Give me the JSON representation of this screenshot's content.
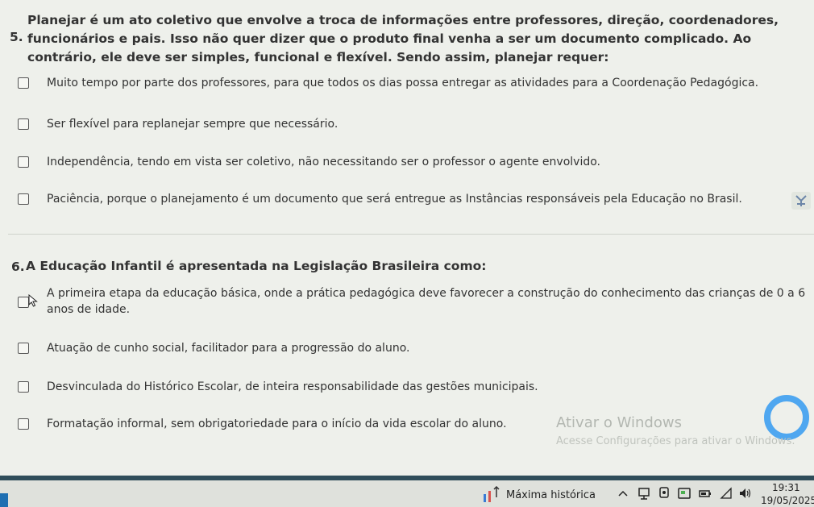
{
  "question5": {
    "number": "5.",
    "prompt": "Planejar é um ato coletivo que envolve a troca de informações entre professores, direção, coordenadores, funcionários e pais. Isso não quer dizer que o produto final venha a ser um documento complicado. Ao contrário, ele deve ser simples, funcional e flexível. Sendo assim, planejar requer:",
    "options": [
      "Muito tempo por parte dos professores, para que todos os dias possa entregar as atividades para a Coordenação Pedagógica.",
      "Ser flexível para replanejar sempre que necessário.",
      "Independência, tendo em vista ser coletivo, não necessitando ser o professor o agente envolvido.",
      "Paciência, porque o planejamento é um documento que será entregue as Instâncias responsáveis pela Educação no Brasil."
    ]
  },
  "question6": {
    "number": "6.",
    "prompt": "A Educação Infantil é apresentada na Legislação Brasileira como:",
    "options": [
      "A primeira etapa da educação básica, onde a prática pedagógica deve favorecer a construção do conhecimento das crianças de 0 a 6 anos de idade.",
      "Atuação de cunho social, facilitador para a progressão do aluno.",
      "Desvinculada do Histórico Escolar, de inteira responsabilidade das gestões municipais.",
      "Formatação informal, sem obrigatoriedade para o início da vida escolar do aluno."
    ]
  },
  "watermark": {
    "title": "Ativar o Windows",
    "subtitle": "Acesse Configurações para ativar o Windows."
  },
  "taskbar": {
    "stock_text": "Máxima histórica",
    "time": "19:31",
    "date": "19/05/2025",
    "tray_icons": [
      "chevron-up-icon",
      "network-icon",
      "taskview-icon",
      "screen-icon",
      "battery-icon",
      "wifi-icon",
      "volume-icon"
    ]
  },
  "colors": {
    "accent": "#4fa7f0",
    "taskbar": "#dfe1dc",
    "bluebar": "#2f4d5a"
  }
}
